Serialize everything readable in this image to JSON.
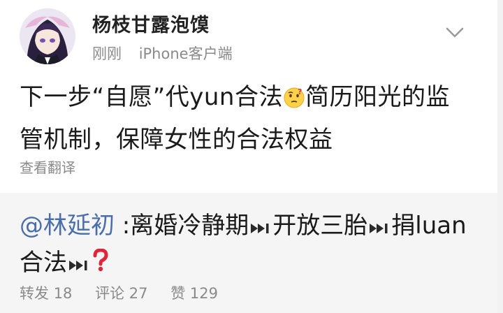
{
  "post": {
    "username": "杨枝甘露泡馍",
    "time": "刚刚",
    "device": "iPhone客户端",
    "text_part1": "下一步“自愿”代yun合法",
    "text_part2": "简历阳光的监管机制，保障女性的合法权益",
    "emoji_icon": "thinking-face-emoji",
    "translate_label": "查看翻译"
  },
  "repost": {
    "mention": "@林延初",
    "sep": " :",
    "items": [
      "离婚冷静期",
      "开放三胎",
      "捐luan合法"
    ],
    "next_icon": "next-track-icon",
    "end_icon": "red-question-mark-icon",
    "stats": {
      "repost_label": "转发",
      "repost_count": "18",
      "comment_label": "评论",
      "comment_count": "27",
      "like_label": "赞",
      "like_count": "129"
    }
  },
  "colors": {
    "mention": "#4a6fa8",
    "meta_text": "#8a8a8a",
    "repost_bg": "#f5f5f5",
    "question_mark": "#e0243a"
  }
}
